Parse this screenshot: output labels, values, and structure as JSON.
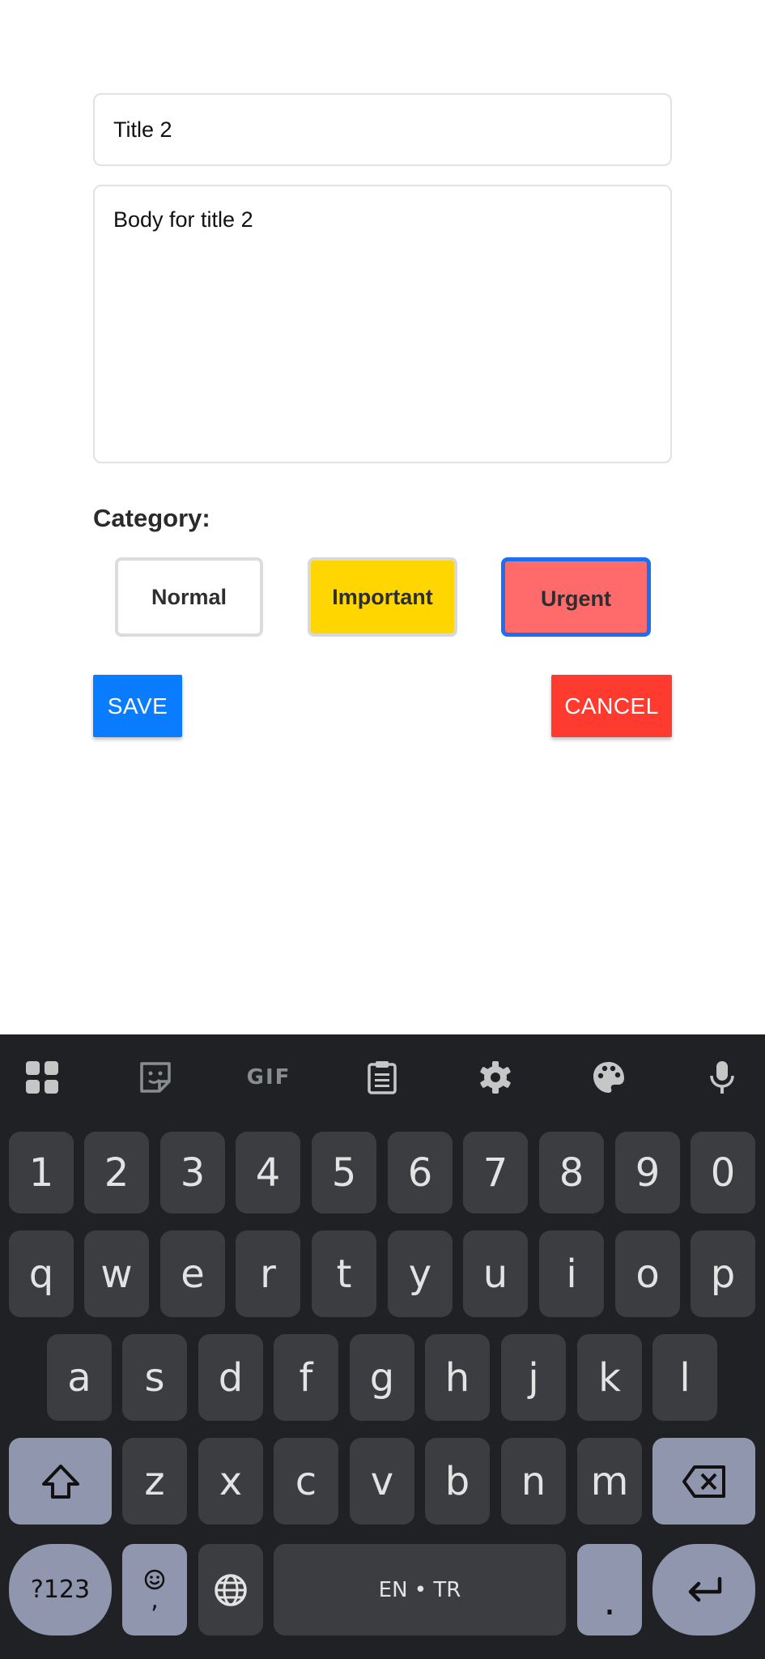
{
  "form": {
    "title_value": "Title 2",
    "body_value": "Body for title 2",
    "category_label": "Category:",
    "categories": [
      "Normal",
      "Important",
      "Urgent"
    ],
    "selected_category": "Urgent",
    "save_label": "SAVE",
    "cancel_label": "CANCEL"
  },
  "colors": {
    "normal": "#ffffff",
    "important": "#ffd600",
    "urgent": "#ff6b6b",
    "selected_border": "#1b6ff0",
    "save": "#0a7cff",
    "cancel": "#ff3b30"
  },
  "keyboard": {
    "toolbar": [
      "apps-icon",
      "sticker-icon",
      "gif-icon",
      "clipboard-icon",
      "settings-icon",
      "palette-icon",
      "microphone-icon"
    ],
    "gif_label": "GIF",
    "row_numbers": [
      "1",
      "2",
      "3",
      "4",
      "5",
      "6",
      "7",
      "8",
      "9",
      "0"
    ],
    "row_1": [
      "q",
      "w",
      "e",
      "r",
      "t",
      "y",
      "u",
      "i",
      "o",
      "p"
    ],
    "row_2": [
      "a",
      "s",
      "d",
      "f",
      "g",
      "h",
      "j",
      "k",
      "l"
    ],
    "row_3": [
      "z",
      "x",
      "c",
      "v",
      "b",
      "n",
      "m"
    ],
    "symbols_label": "?123",
    "comma_label": ",",
    "space_label": "EN • TR",
    "period_label": "."
  }
}
